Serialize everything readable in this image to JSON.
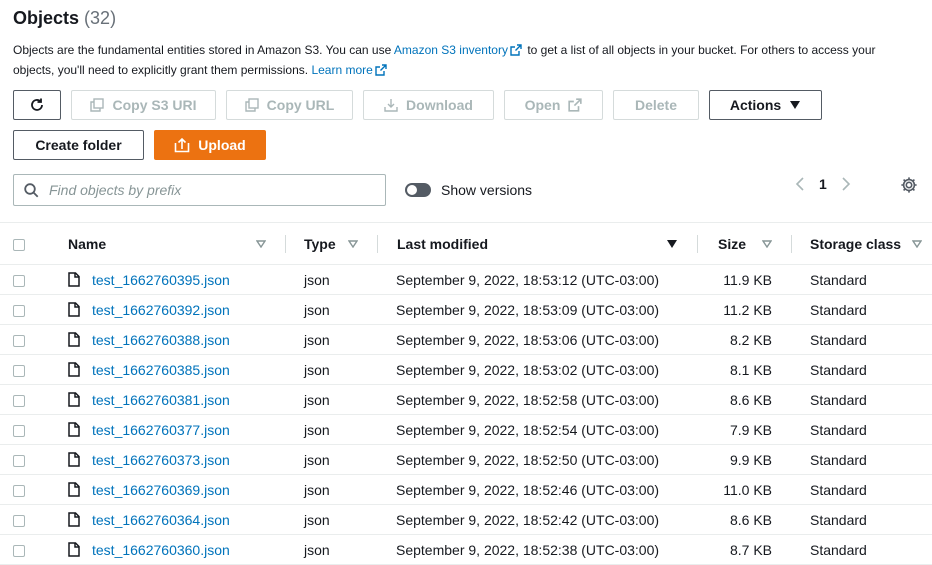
{
  "header": {
    "title": "Objects",
    "count": "(32)"
  },
  "description": {
    "part1": "Objects are the fundamental entities stored in Amazon S3. You can use ",
    "link1": "Amazon S3 inventory",
    "part2": " to get a list of all objects in your bucket. For others to access your objects, you'll need to explicitly grant them permissions. ",
    "link2": "Learn more"
  },
  "toolbar": {
    "copy_s3_uri": "Copy S3 URI",
    "copy_url": "Copy URL",
    "download": "Download",
    "open": "Open",
    "delete": "Delete",
    "actions": "Actions",
    "create_folder": "Create folder",
    "upload": "Upload"
  },
  "search": {
    "placeholder": "Find objects by prefix",
    "value": ""
  },
  "versions": {
    "label": "Show versions",
    "enabled": false
  },
  "pagination": {
    "current_page": "1"
  },
  "table": {
    "columns": {
      "name": "Name",
      "type": "Type",
      "last_modified": "Last modified",
      "size": "Size",
      "storage_class": "Storage class"
    },
    "rows": [
      {
        "name": "test_1662760395.json",
        "type": "json",
        "modified": "September 9, 2022, 18:53:12 (UTC-03:00)",
        "size": "11.9 KB",
        "storage": "Standard"
      },
      {
        "name": "test_1662760392.json",
        "type": "json",
        "modified": "September 9, 2022, 18:53:09 (UTC-03:00)",
        "size": "11.2 KB",
        "storage": "Standard"
      },
      {
        "name": "test_1662760388.json",
        "type": "json",
        "modified": "September 9, 2022, 18:53:06 (UTC-03:00)",
        "size": "8.2 KB",
        "storage": "Standard"
      },
      {
        "name": "test_1662760385.json",
        "type": "json",
        "modified": "September 9, 2022, 18:53:02 (UTC-03:00)",
        "size": "8.1 KB",
        "storage": "Standard"
      },
      {
        "name": "test_1662760381.json",
        "type": "json",
        "modified": "September 9, 2022, 18:52:58 (UTC-03:00)",
        "size": "8.6 KB",
        "storage": "Standard"
      },
      {
        "name": "test_1662760377.json",
        "type": "json",
        "modified": "September 9, 2022, 18:52:54 (UTC-03:00)",
        "size": "7.9 KB",
        "storage": "Standard"
      },
      {
        "name": "test_1662760373.json",
        "type": "json",
        "modified": "September 9, 2022, 18:52:50 (UTC-03:00)",
        "size": "9.9 KB",
        "storage": "Standard"
      },
      {
        "name": "test_1662760369.json",
        "type": "json",
        "modified": "September 9, 2022, 18:52:46 (UTC-03:00)",
        "size": "11.0 KB",
        "storage": "Standard"
      },
      {
        "name": "test_1662760364.json",
        "type": "json",
        "modified": "September 9, 2022, 18:52:42 (UTC-03:00)",
        "size": "8.6 KB",
        "storage": "Standard"
      },
      {
        "name": "test_1662760360.json",
        "type": "json",
        "modified": "September 9, 2022, 18:52:38 (UTC-03:00)",
        "size": "8.7 KB",
        "storage": "Standard"
      }
    ]
  },
  "colors": {
    "link": "#0073bb",
    "primary": "#ec7211",
    "disabled": "#aab7b8",
    "text": "#16191f"
  }
}
